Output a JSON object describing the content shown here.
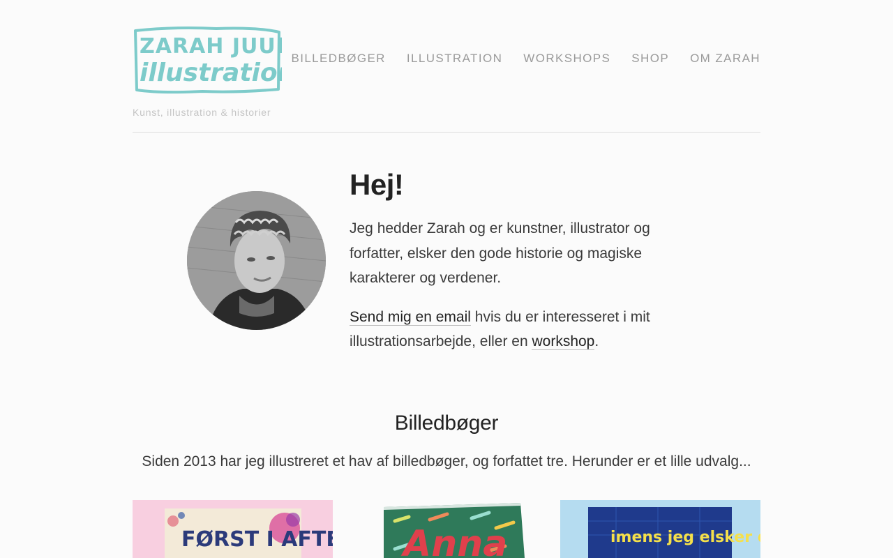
{
  "header": {
    "logo": {
      "line1": "ZARAH JUUL",
      "line2": "illustration",
      "color": "#7dcbca"
    },
    "tagline": "Kunst, illustration & historier",
    "nav": [
      {
        "label": "BILLEDBØGER"
      },
      {
        "label": "ILLUSTRATION"
      },
      {
        "label": "WORKSHOPS"
      },
      {
        "label": "SHOP"
      },
      {
        "label": "OM ZARAH"
      }
    ]
  },
  "intro": {
    "heading": "Hej!",
    "paragraph1": "Jeg hedder Zarah og er kunstner, illustrator og forfatter, elsker den gode historie og magiske karakterer og verdener.",
    "email_link": "Send mig en email",
    "paragraph2_mid": " hvis du er interesseret i mit illustrationsarbejde, eller en ",
    "workshop_link": "workshop",
    "paragraph2_end": "."
  },
  "books_section": {
    "title": "Billedbøger",
    "text": "Siden 2013 har jeg illustreret et hav af billedbøger, og forfattet tre. Herunder er et lille udvalg...",
    "books": [
      {
        "cover_text": "FØRST I AFTEN",
        "bg": "#f8cfe0",
        "cover": "#f3ead8",
        "text_color": "#2b3a7a"
      },
      {
        "cover_text": "Anna",
        "bg": "#fbfbfb",
        "cover": "#2f7a5a",
        "text_color": "#e0404c"
      },
      {
        "cover_text": "imens jeg elsker dig",
        "bg": "#b5dcf0",
        "cover": "#1f3a8c",
        "text_color": "#f5e04a"
      }
    ]
  },
  "colors": {
    "accent": "#7dcbca",
    "nav": "#9a9a9a",
    "heading": "#222222",
    "body": "#3a3a3a",
    "page_bg": "#fbfbfb"
  }
}
